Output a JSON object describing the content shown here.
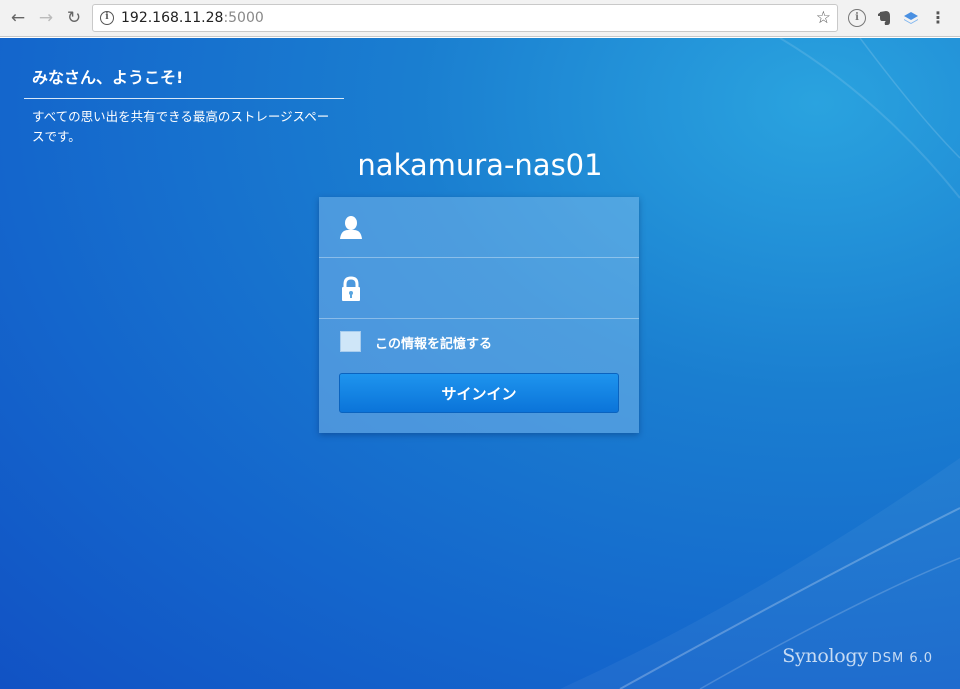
{
  "browser": {
    "back_icon": "back-arrow-icon",
    "forward_icon": "forward-arrow-icon",
    "reload_icon": "reload-icon",
    "url_host": "192.168.11.28",
    "url_port": ":5000"
  },
  "welcome": {
    "title": "みなさん、ようこそ!",
    "subtitle": "すべての思い出を共有できる最高のストレージスペースです。"
  },
  "login": {
    "hostname": "nakamura-nas01",
    "username_value": "",
    "password_value": "",
    "remember_label": "この情報を記憶する",
    "remember_checked": false,
    "signin_label": "サインイン"
  },
  "branding": {
    "name": "Synology",
    "product": "DSM 6.0"
  },
  "colors": {
    "background": "#1466cc",
    "button": "#0b74d9"
  }
}
